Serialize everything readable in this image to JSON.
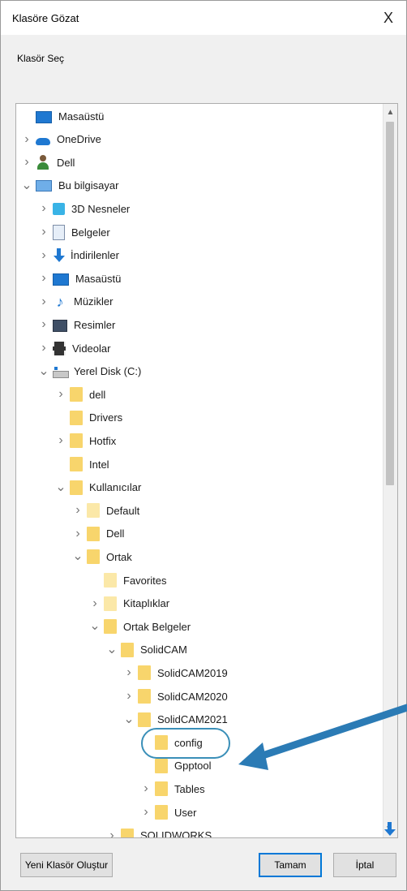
{
  "window": {
    "title": "Klasöre Gözat",
    "close_glyph": "X"
  },
  "prompt": "Klasör Seç",
  "tree": [
    {
      "label": "Masaüstü",
      "icon": "desktop-icon",
      "depth": 0,
      "expander": "none"
    },
    {
      "label": "OneDrive",
      "icon": "cloud-icon",
      "depth": 0,
      "expander": "collapsed"
    },
    {
      "label": "Dell",
      "icon": "user-icon",
      "depth": 0,
      "expander": "collapsed"
    },
    {
      "label": "Bu bilgisayar",
      "icon": "computer-icon",
      "depth": 0,
      "expander": "expanded"
    },
    {
      "label": "3D Nesneler",
      "icon": "cube-icon",
      "depth": 1,
      "expander": "collapsed"
    },
    {
      "label": "Belgeler",
      "icon": "document-icon",
      "depth": 1,
      "expander": "collapsed"
    },
    {
      "label": "İndirilenler",
      "icon": "download-icon",
      "depth": 1,
      "expander": "collapsed"
    },
    {
      "label": "Masaüstü",
      "icon": "desktop-icon",
      "depth": 1,
      "expander": "collapsed"
    },
    {
      "label": "Müzikler",
      "icon": "music-icon",
      "depth": 1,
      "expander": "collapsed"
    },
    {
      "label": "Resimler",
      "icon": "pictures-icon",
      "depth": 1,
      "expander": "collapsed"
    },
    {
      "label": "Videolar",
      "icon": "video-icon",
      "depth": 1,
      "expander": "collapsed"
    },
    {
      "label": "Yerel Disk (C:)",
      "icon": "drive-icon",
      "depth": 1,
      "expander": "expanded"
    },
    {
      "label": "dell",
      "icon": "folder-icon",
      "depth": 2,
      "expander": "collapsed"
    },
    {
      "label": "Drivers",
      "icon": "folder-icon",
      "depth": 2,
      "expander": "none"
    },
    {
      "label": "Hotfix",
      "icon": "folder-icon",
      "depth": 2,
      "expander": "collapsed"
    },
    {
      "label": "Intel",
      "icon": "folder-icon",
      "depth": 2,
      "expander": "none"
    },
    {
      "label": "Kullanıcılar",
      "icon": "folder-icon",
      "depth": 2,
      "expander": "expanded"
    },
    {
      "label": "Default",
      "icon": "folder-light-icon",
      "depth": 3,
      "expander": "collapsed"
    },
    {
      "label": "Dell",
      "icon": "folder-icon",
      "depth": 3,
      "expander": "collapsed"
    },
    {
      "label": "Ortak",
      "icon": "folder-icon",
      "depth": 3,
      "expander": "expanded"
    },
    {
      "label": "Favorites",
      "icon": "folder-light-icon",
      "depth": 4,
      "expander": "none"
    },
    {
      "label": "Kitaplıklar",
      "icon": "folder-light-icon",
      "depth": 4,
      "expander": "collapsed"
    },
    {
      "label": "Ortak Belgeler",
      "icon": "folder-icon",
      "depth": 4,
      "expander": "expanded"
    },
    {
      "label": "SolidCAM",
      "icon": "folder-icon",
      "depth": 5,
      "expander": "expanded"
    },
    {
      "label": "SolidCAM2019",
      "icon": "folder-icon",
      "depth": 6,
      "expander": "collapsed"
    },
    {
      "label": "SolidCAM2020",
      "icon": "folder-icon",
      "depth": 6,
      "expander": "collapsed"
    },
    {
      "label": "SolidCAM2021",
      "icon": "folder-icon",
      "depth": 6,
      "expander": "expanded"
    },
    {
      "label": "config",
      "icon": "folder-icon",
      "depth": 7,
      "expander": "none"
    },
    {
      "label": "Gpptool",
      "icon": "folder-icon",
      "depth": 7,
      "expander": "none",
      "highlighted": true
    },
    {
      "label": "Tables",
      "icon": "folder-icon",
      "depth": 7,
      "expander": "collapsed"
    },
    {
      "label": "User",
      "icon": "folder-icon",
      "depth": 7,
      "expander": "collapsed"
    },
    {
      "label": "SOLIDWORKS",
      "icon": "folder-icon",
      "depth": 5,
      "expander": "collapsed"
    }
  ],
  "buttons": {
    "new_folder": "Yeni Klasör Oluştur",
    "ok": "Tamam",
    "cancel": "İptal"
  },
  "colors": {
    "annotation_arrow": "#2b7bb5",
    "folder": "#f8d56c",
    "folder_light": "#fbe8a8",
    "accent": "#0078d7"
  }
}
